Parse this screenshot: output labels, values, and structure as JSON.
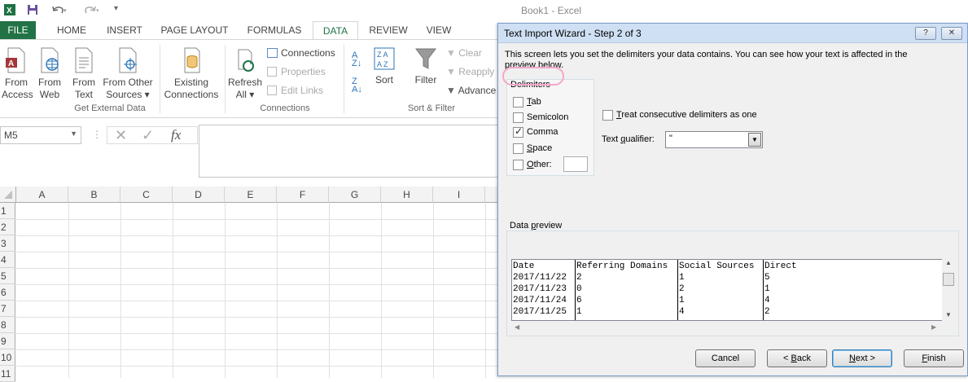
{
  "window": {
    "title": "Book1 - Excel"
  },
  "tabs": [
    "FILE",
    "HOME",
    "INSERT",
    "PAGE LAYOUT",
    "FORMULAS",
    "DATA",
    "REVIEW",
    "VIEW"
  ],
  "ribbon": {
    "get_external": {
      "from_access": [
        "From",
        "Access"
      ],
      "from_web": [
        "From",
        "Web"
      ],
      "from_text": [
        "From",
        "Text"
      ],
      "from_other": [
        "From Other",
        "Sources ▾"
      ],
      "existing": [
        "Existing",
        "Connections"
      ],
      "group_label": "Get External Data"
    },
    "connections": {
      "refresh": [
        "Refresh",
        "All ▾"
      ],
      "connections": "Connections",
      "properties": "Properties",
      "edit_links": "Edit Links",
      "group_label": "Connections"
    },
    "sort_filter": {
      "sort": "Sort",
      "filter": "Filter",
      "clear": "Clear",
      "reapply": "Reapply",
      "advanced": "Advance",
      "group_label": "Sort & Filter"
    }
  },
  "formula_bar": {
    "name_box": "M5",
    "fx": "fx"
  },
  "grid": {
    "columns": [
      "A",
      "B",
      "C",
      "D",
      "E",
      "F",
      "G",
      "H",
      "I"
    ],
    "rows": [
      "1",
      "2",
      "3",
      "4",
      "5",
      "6",
      "7",
      "8",
      "9",
      "10",
      "11"
    ]
  },
  "dialog": {
    "title": "Text Import Wizard - Step 2 of 3",
    "help_btn": "?",
    "close_btn": "✕",
    "intro_line1": "This screen lets you set the delimiters your data contains.  You can see how your text is affected in the",
    "intro_line2": "preview below.",
    "delimiters_label": "Delimiters",
    "delimiters": [
      {
        "key": "T",
        "rest": "ab",
        "checked": false
      },
      {
        "key": "",
        "rest": "Semicolon",
        "checked": false
      },
      {
        "key": "",
        "rest": "Comma",
        "checked": true
      },
      {
        "key": "S",
        "rest": "pace",
        "checked": false
      },
      {
        "key": "O",
        "rest": "ther:",
        "checked": false
      }
    ],
    "treat_consecutive": {
      "key": "T",
      "rest": "reat consecutive delimiters as one",
      "checked": false
    },
    "text_qualifier": {
      "pre": "Text ",
      "key": "q",
      "post": "ualifier:",
      "value": "\""
    },
    "preview_label_pre": "Data ",
    "preview_label_key": "p",
    "preview_label_post": "review",
    "preview": {
      "headers": [
        "Date",
        "Referring Domains",
        "Social Sources",
        "Direct"
      ],
      "rows": [
        [
          "2017/11/22",
          "2",
          "1",
          "5"
        ],
        [
          "2017/11/23",
          "0",
          "2",
          "1"
        ],
        [
          "2017/11/24",
          "6",
          "1",
          "4"
        ],
        [
          "2017/11/25",
          "1",
          "4",
          "2"
        ]
      ]
    },
    "buttons": {
      "cancel": "Cancel",
      "back_pre": "< ",
      "back_key": "B",
      "back_post": "ack",
      "next_key": "N",
      "next_post": "ext >",
      "finish_key": "F",
      "finish_post": "inish"
    }
  }
}
